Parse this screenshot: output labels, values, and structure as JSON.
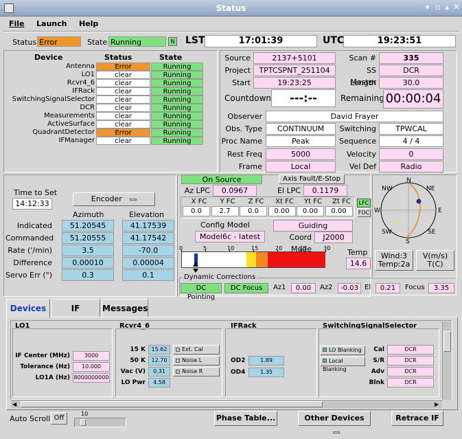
{
  "window": {
    "title": "Status"
  },
  "menu": [
    "File",
    "Launch",
    "Help"
  ],
  "header": {
    "status_label": "Status",
    "status_value": "Error",
    "state_label": "State",
    "state_value": "Running",
    "state_flag": "N",
    "lst_label": "LST",
    "lst_value": "17:01:39",
    "utc_label": "UTC",
    "utc_value": "19:23:51"
  },
  "devices": {
    "headers": [
      "Device",
      "Status",
      "State"
    ],
    "rows": [
      {
        "name": "Antenna",
        "status": "Error",
        "state": "Running"
      },
      {
        "name": "LO1",
        "status": "clear",
        "state": "Running"
      },
      {
        "name": "Rcvr4_6",
        "status": "clear",
        "state": "Running"
      },
      {
        "name": "IFRack",
        "status": "clear",
        "state": "Running"
      },
      {
        "name": "SwitchingSignalSelector",
        "status": "clear",
        "state": "Running"
      },
      {
        "name": "DCR",
        "status": "clear",
        "state": "Running"
      },
      {
        "name": "Measurements",
        "status": "clear",
        "state": "Running"
      },
      {
        "name": "ActiveSurface",
        "status": "clear",
        "state": "Running"
      },
      {
        "name": "QuadrantDetector",
        "status": "Error",
        "state": "Running"
      },
      {
        "name": "IFManager",
        "status": "clear",
        "state": "Running"
      }
    ]
  },
  "scan": {
    "source_label": "Source",
    "source": "2137+5101",
    "scan_label": "Scan #",
    "scan": "335",
    "project_label": "Project",
    "project": "TPTCSPNT_251104",
    "ssmaster_label": "SS Master",
    "ssmaster": "DCR",
    "start_label": "Start",
    "start": "19:23:25",
    "length_label": "Length",
    "length": "30.0",
    "countdown_label": "Countdown",
    "countdown": "---:--",
    "remaining_label": "Remaining",
    "remaining": "00:00:04",
    "observer_label": "Observer",
    "observer": "David Frayer",
    "obstype_label": "Obs. Type",
    "obstype": "CONTINUUM",
    "switching_label": "Switching",
    "switching": "TPWCAL",
    "procname_label": "Proc Name",
    "procname": "Peak",
    "sequence_label": "Sequence",
    "sequence": "4 / 4",
    "restfreq_label": "Rest Freq",
    "restfreq": "5000",
    "velocity_label": "Velocity",
    "velocity": "0",
    "frame_label": "Frame",
    "frame": "Local",
    "veldef_label": "Vel Def",
    "veldef": "Radio"
  },
  "pointing": {
    "time_to_set_label": "Time to Set",
    "time_to_set": "14:12:33",
    "encoder": "Encoder",
    "az_header": "Azimuth",
    "el_header": "Elevation",
    "rows": [
      {
        "label": "Indicated",
        "az": "51.20545",
        "el": "41.17539"
      },
      {
        "label": "Commanded",
        "az": "51.20555",
        "el": "41.17542"
      },
      {
        "label": "Rate ('/min)",
        "az": "3.5",
        "el": "-70.0"
      },
      {
        "label": "Difference",
        "az": "0.00010",
        "el": "0.00004"
      },
      {
        "label": "Servo Err (\")",
        "az": "0.3",
        "el": "0.1"
      }
    ]
  },
  "mid": {
    "on_source": "On Source",
    "axis_fault": "Axis Fault/E-Stop",
    "azlpc_label": "Az LPC",
    "azlpc": "0.0967",
    "ellpc_label": "El LPC",
    "ellpc": "0.1179",
    "fc_labels": [
      "X FC",
      "Y FC",
      "Z FC",
      "Xt FC",
      "Yt FC",
      "Zt FC"
    ],
    "fc_values": [
      "0.0",
      "2.7",
      "0.0",
      "0.00",
      "0.00",
      "0.00"
    ],
    "lfc": "LFC",
    "foc": "FOC",
    "config_model_label": "Config Model",
    "config_model": "Model6c - latest",
    "guiding": "Guiding",
    "coord_mode_label": "Coord Mode",
    "coord_mode": "J2000",
    "wind_ticks": [
      "0",
      "5",
      "10",
      "15",
      "20",
      "25",
      "30"
    ],
    "wind_value": 3,
    "temp_label": "Temp",
    "temp": "14.6",
    "wind_btn_1": "Wind:3",
    "wind_btn_2": "Temp:2a",
    "vel_btn_1": "V(m/s)",
    "vel_btn_2": "T(C)",
    "dyn_title": "Dynamic Corrections",
    "dc_pointing": "DC Pointing",
    "dc_focus": "DC Focus",
    "az1_label": "Az1",
    "az1": "0.00",
    "az2_label": "Az2",
    "az2": "-0.03",
    "el_label": "El",
    "el": "0.21",
    "focus_label": "Focus",
    "focus": "3.35"
  },
  "compass": {
    "labels": [
      "N",
      "NE",
      "E",
      "SE",
      "S",
      "SW",
      "W",
      "NW"
    ]
  },
  "tabs": [
    "Devices",
    "IF Manager",
    "Messages"
  ],
  "lo1": {
    "title": "LO1",
    "rows": [
      {
        "label": "IF Center (MHz)",
        "value": "3000"
      },
      {
        "label": "Tolerance (Hz)",
        "value": "10.000"
      },
      {
        "label": "LO1A (Hz)",
        "value": "8000000000"
      }
    ]
  },
  "rcvr": {
    "title": "Rcvr4_6",
    "rows": [
      {
        "label": "15 K",
        "value": "15.62",
        "opt": "Ext. Cal"
      },
      {
        "label": "50 K",
        "value": "12.70",
        "opt": "Noise L"
      },
      {
        "label": "Vac (V)",
        "value": "0.31",
        "opt": "Noise R"
      },
      {
        "label": "LO Pwr",
        "value": "4.58",
        "opt": ""
      }
    ]
  },
  "ifrack": {
    "title": "IFRack",
    "rows": [
      {
        "label": "OD2",
        "value": "1.89"
      },
      {
        "label": "OD4",
        "value": "1.35"
      }
    ]
  },
  "sss": {
    "title": "SwitchingSignalSelector",
    "blank_1": "LO Blanking",
    "blank_2": "Local Blanking",
    "rows": [
      {
        "label": "Cal",
        "value": "DCR"
      },
      {
        "label": "S/R",
        "value": "DCR"
      },
      {
        "label": "Adv",
        "value": "DCR"
      },
      {
        "label": "Blnk",
        "value": "DCR"
      }
    ]
  },
  "footer": {
    "autoscroll_label": "Auto Scroll",
    "autoscroll": "Off",
    "slider_value": "10",
    "phase_table": "Phase Table...",
    "other_devices": "Other Devices",
    "retrace_if": "Retrace IF"
  }
}
